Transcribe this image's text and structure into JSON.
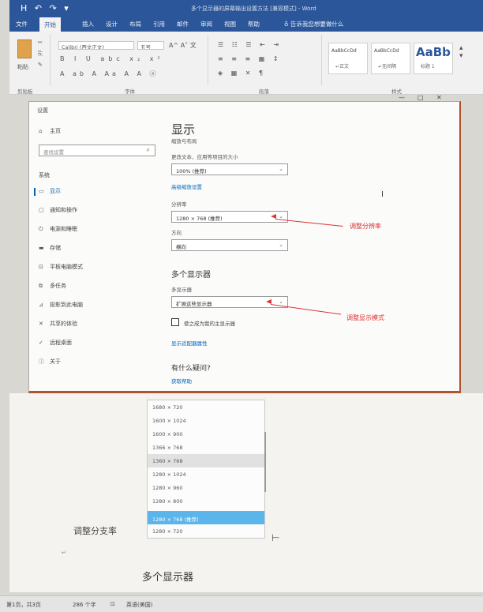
{
  "word": {
    "title": "多个显示器的屏幕输出设置方法 [兼容模式] - Word",
    "quick_access": "H ↶ ↷ ▾",
    "tell_me": "告诉我您想要做什么",
    "tabs": [
      "文件",
      "开始",
      "插入",
      "设计",
      "布局",
      "引用",
      "邮件",
      "审阅",
      "视图",
      "帮助"
    ],
    "ribbon": {
      "paste_label": "粘贴",
      "clipboard_label": "剪贴板",
      "font_name": "Calibri (西文正文)",
      "font_size": "五号",
      "font_label": "字体",
      "paragraph_label": "段落",
      "styles_label": "样式",
      "style_sample": "AaBbCcDd",
      "style_big": "AaBb",
      "styles": [
        "↵正文",
        "↵无间隔",
        "标题 1"
      ]
    }
  },
  "settings": {
    "app_title": "设置",
    "window_controls": [
      "—",
      "□",
      "✕"
    ],
    "home": "主页",
    "search_placeholder": "查找设置",
    "section": "系统",
    "nav": [
      {
        "icon": "display-icon",
        "glyph": "▭",
        "label": "显示"
      },
      {
        "icon": "notification-icon",
        "glyph": "▢",
        "label": "通知和操作"
      },
      {
        "icon": "power-icon",
        "glyph": "⏻",
        "label": "电源和睡眠"
      },
      {
        "icon": "storage-icon",
        "glyph": "▬",
        "label": "存储"
      },
      {
        "icon": "tablet-icon",
        "glyph": "⊡",
        "label": "平板电脑模式"
      },
      {
        "icon": "multitask-icon",
        "glyph": "⧉",
        "label": "多任务"
      },
      {
        "icon": "projecting-icon",
        "glyph": "⊿",
        "label": "投影到此电脑"
      },
      {
        "icon": "shared-experiences-icon",
        "glyph": "✕",
        "label": "共享的体验"
      },
      {
        "icon": "remote-desktop-icon",
        "glyph": "✓",
        "label": "远程桌面"
      },
      {
        "icon": "about-icon",
        "glyph": "ⓘ",
        "label": "关于"
      }
    ],
    "page_title": "显示",
    "subtitle": "缩放与布局",
    "scale_label": "更改文本、应用等项目的大小",
    "scale_value": "100% (推荐)",
    "advanced_scaling": "高级缩放设置",
    "resolution_label": "分辨率",
    "resolution_value": "1280 × 768 (推荐)",
    "orientation_label": "方向",
    "orientation_value": "横向",
    "multi_heading": "多个显示器",
    "multi_label": "多显示器",
    "multi_value": "扩展这些显示器",
    "main_display_checkbox": "使之成为我的主显示器",
    "adapter_link": "显示适配器属性",
    "question_heading": "有什么疑问?",
    "help_link": "获取帮助"
  },
  "annotations": {
    "resolution_note": "调整分辨率",
    "mode_note": "调整显示模式"
  },
  "dropdown": {
    "options": [
      "1680 × 720",
      "1600 × 1024",
      "1600 × 900",
      "1366 × 768",
      "1360 × 768",
      "1280 × 1024",
      "1280 × 960",
      "1280 × 800",
      "1280 × 768 (推荐)",
      "1280 × 720"
    ],
    "hovered_index": 4,
    "selected_index": 8
  },
  "document": {
    "caption": "调整分支率",
    "para_mark": "↵",
    "next_heading": "多个显示器"
  },
  "status_bar": {
    "page": "第1页，共3页",
    "words": "286 个字",
    "language": "英语(美国)"
  },
  "colors": {
    "word_blue": "#2b579a",
    "settings_accent": "#0063b1",
    "annotation_red": "#d33333",
    "dropdown_selected": "#5bb4ea"
  }
}
